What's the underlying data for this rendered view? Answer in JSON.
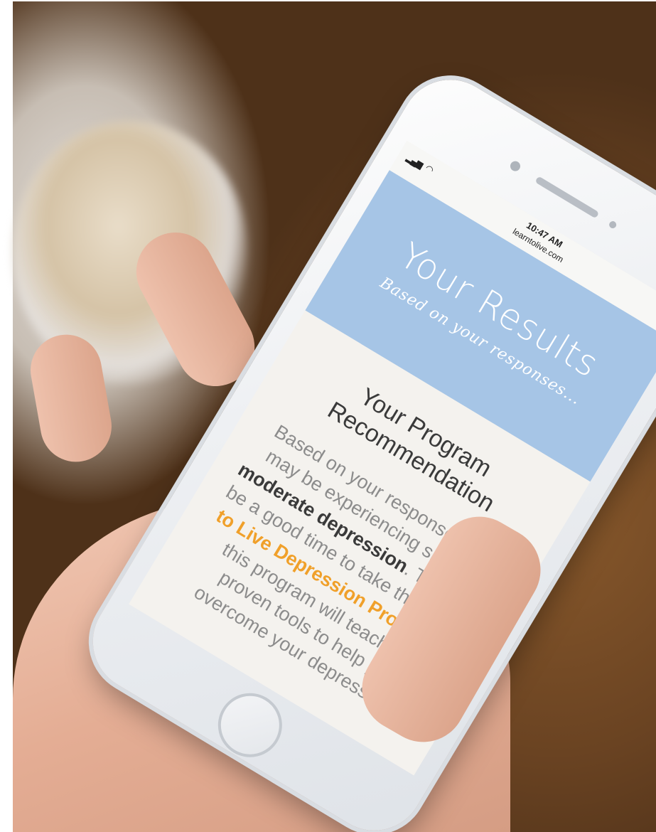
{
  "status_bar": {
    "signal_icon": "signal-bars-icon",
    "wifi_icon": "wifi-icon",
    "time": "10:47 AM",
    "url": "learntolive.com",
    "battery_icon": "battery-icon"
  },
  "banner": {
    "title": "Your Results",
    "subtitle": "Based on your responses..."
  },
  "recommendation": {
    "heading": "Your Program Recommendation",
    "body_part1": "Based on your responses, you may be experiencing signs of ",
    "emphasis": "moderate depression",
    "body_part2": ". This may be a good time to take the ",
    "program_link": "Learn to Live Depression Program",
    "body_part3": " – this program will teach you proven tools to help you overcome your depression."
  },
  "colors": {
    "banner_bg": "#a6c5e6",
    "screen_bg": "#f4f2ee",
    "link": "#f0a02a",
    "body_text": "#8c8c8c"
  }
}
